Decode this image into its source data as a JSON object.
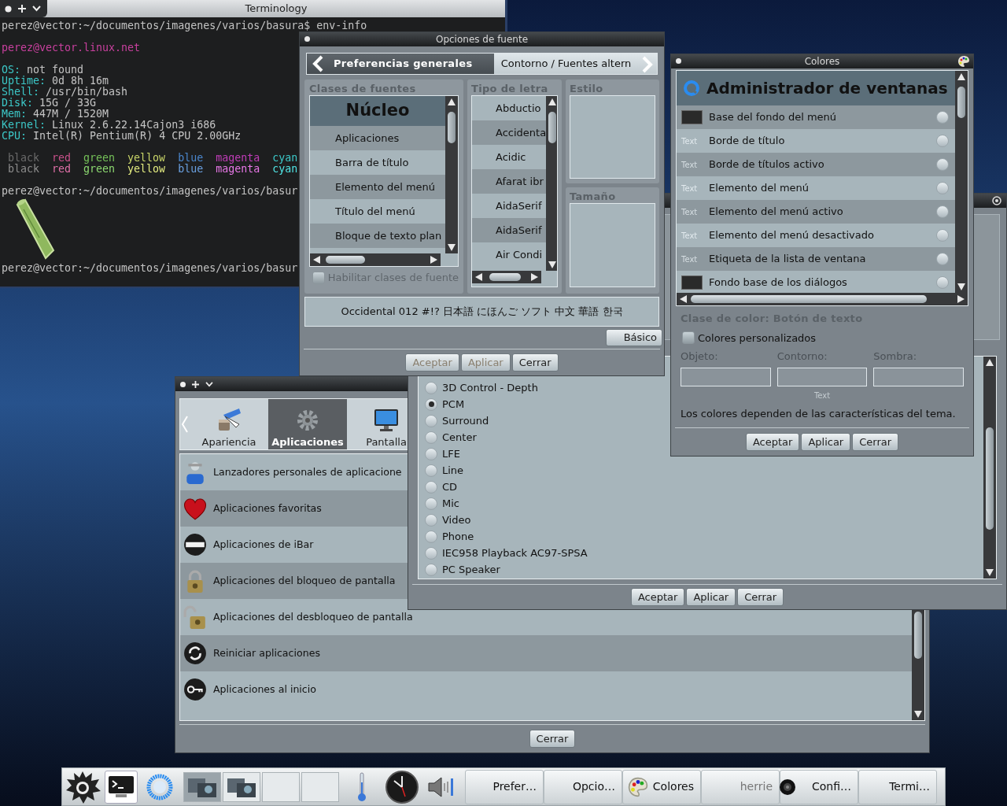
{
  "terminal": {
    "title": "Terminology",
    "lines": [
      {
        "kind": "prompt",
        "text": "perez@vector:~/documentos/imagenes/varios/basura$ env-info"
      },
      {
        "kind": "blank"
      },
      {
        "kind": "host",
        "text": "perez@vector.linux.net"
      },
      {
        "kind": "blank"
      },
      {
        "kind": "info",
        "label": "OS:",
        "value": "not found"
      },
      {
        "kind": "info",
        "label": "Uptime:",
        "value": "0d 8h 16m"
      },
      {
        "kind": "info",
        "label": "Shell:",
        "value": "/usr/bin/bash"
      },
      {
        "kind": "info",
        "label": "Disk:",
        "value": "15G / 33G"
      },
      {
        "kind": "info",
        "label": "Mem:",
        "value": "447M / 1520M"
      },
      {
        "kind": "info",
        "label": "Kernel:",
        "value": "Linux 2.6.22.14Cajon3 i686"
      },
      {
        "kind": "info",
        "label": "CPU:",
        "value": "Intel(R) Pentium(R) 4 CPU 2.00GHz"
      },
      {
        "kind": "blank"
      },
      {
        "kind": "palette",
        "colors": [
          {
            "text": "black",
            "color": "#6a6a6a"
          },
          {
            "text": "red",
            "color": "#c8508a"
          },
          {
            "text": "green",
            "color": "#74c058"
          },
          {
            "text": "yellow",
            "color": "#c8d468"
          },
          {
            "text": "blue",
            "color": "#4a86cc"
          },
          {
            "text": "magenta",
            "color": "#c03cb8"
          },
          {
            "text": "cyan",
            "color": "#3cc8c8"
          }
        ]
      },
      {
        "kind": "palette",
        "colors": [
          {
            "text": "black",
            "color": "#8c8c8c"
          },
          {
            "text": "red",
            "color": "#e070a8"
          },
          {
            "text": "green",
            "color": "#8cd870"
          },
          {
            "text": "yellow",
            "color": "#e4ec80"
          },
          {
            "text": "blue",
            "color": "#6aa0e0"
          },
          {
            "text": "magenta",
            "color": "#e878e8"
          },
          {
            "text": "cyan",
            "color": "#50e4e4"
          }
        ]
      },
      {
        "kind": "blank"
      },
      {
        "kind": "prompt",
        "text": "perez@vector:~/documentos/imagenes/varios/basur"
      },
      {
        "kind": "image"
      },
      {
        "kind": "prompt",
        "text": "perez@vector:~/documentos/imagenes/varios/basur"
      }
    ]
  },
  "settings_window": {
    "tabs": [
      {
        "label": "Apariencia",
        "selected": false
      },
      {
        "label": "Aplicaciones",
        "selected": true
      },
      {
        "label": "Pantalla",
        "selected": false
      }
    ],
    "items": [
      {
        "label": "Lanzadores personales de aplicacione"
      },
      {
        "label": "Aplicaciones favoritas"
      },
      {
        "label": "Aplicaciones de iBar"
      },
      {
        "label": "Aplicaciones del bloqueo de pantalla"
      },
      {
        "label": "Aplicaciones del desbloqueo de pantalla"
      },
      {
        "label": "Reiniciar aplicaciones"
      },
      {
        "label": "Aplicaciones al inicio"
      }
    ],
    "buttons": [
      {
        "label": "Cerrar",
        "disabled": false
      }
    ]
  },
  "mixer_window": {
    "channels": [
      {
        "label": "3D Control - Depth",
        "selected": false
      },
      {
        "label": "PCM",
        "selected": true
      },
      {
        "label": "Surround",
        "selected": false
      },
      {
        "label": "Center",
        "selected": false
      },
      {
        "label": "LFE",
        "selected": false
      },
      {
        "label": "Line",
        "selected": false
      },
      {
        "label": "CD",
        "selected": false
      },
      {
        "label": "Mic",
        "selected": false
      },
      {
        "label": "Video",
        "selected": false
      },
      {
        "label": "Phone",
        "selected": false
      },
      {
        "label": "IEC958 Playback AC97-SPSA",
        "selected": false
      },
      {
        "label": "PC Speaker",
        "selected": false
      }
    ],
    "buttons": [
      {
        "label": "Aceptar",
        "disabled": false
      },
      {
        "label": "Aplicar",
        "disabled": false
      },
      {
        "label": "Cerrar",
        "disabled": false
      }
    ]
  },
  "font_window": {
    "title": "Opciones de fuente",
    "tabs": [
      {
        "label": "Preferencias generales",
        "selected": true
      },
      {
        "label": "Contorno / Fuentes altern",
        "selected": false
      }
    ],
    "classes": {
      "heading": "Clases de fuentes",
      "items": [
        {
          "kind": "header",
          "label": "Núcleo"
        },
        {
          "kind": "item",
          "label": "Aplicaciones"
        },
        {
          "kind": "item",
          "label": "Barra de título"
        },
        {
          "kind": "item",
          "label": "Elemento del menú"
        },
        {
          "kind": "item",
          "label": "Título del menú"
        },
        {
          "kind": "item",
          "label": "Bloque de texto plan"
        }
      ]
    },
    "enable_classes": {
      "label": "Habilitar clases de fuente",
      "checked": false,
      "disabled": true
    },
    "typefaces": {
      "heading": "Tipo de letra",
      "items": [
        {
          "label": "Abductio"
        },
        {
          "label": "Accidenta"
        },
        {
          "label": "Acidic"
        },
        {
          "label": "Afarat ibr"
        },
        {
          "label": "AidaSerif"
        },
        {
          "label": "AidaSerif"
        },
        {
          "label": "Air Condi"
        }
      ]
    },
    "style": {
      "heading": "Estilo"
    },
    "size": {
      "heading": "Tamaño"
    },
    "sample": "Occidental 012 #!? 日本語 にほんご ソフト 中文 華語 한국",
    "basic_button": "Básico",
    "buttons": [
      {
        "label": "Aceptar",
        "disabled": true
      },
      {
        "label": "Aplicar",
        "disabled": true
      },
      {
        "label": "Cerrar",
        "disabled": false
      }
    ]
  },
  "colors_window": {
    "title": "Colores",
    "list_header": "Administrador de ventanas",
    "items": [
      {
        "kind": "swatch",
        "label": "Base del fondo del menú",
        "selected": false
      },
      {
        "kind": "text",
        "sample": "Text",
        "label": "Borde de título",
        "selected": false
      },
      {
        "kind": "text",
        "sample": "Text",
        "label": "Borde de títulos activo",
        "selected": false
      },
      {
        "kind": "text",
        "sample": "Text",
        "label": "Elemento del menú",
        "selected": false
      },
      {
        "kind": "text",
        "sample": "Text",
        "label": "Elemento del menú activo",
        "selected": false
      },
      {
        "kind": "text",
        "sample": "Text",
        "label": "Elemento del menú desactivado",
        "selected": false
      },
      {
        "kind": "text",
        "sample": "Text",
        "label": "Etiqueta de la lista de ventana",
        "selected": false
      },
      {
        "kind": "swatch",
        "label": "Fondo base de los diálogos",
        "selected": false
      }
    ],
    "class_title": "Clase de color: Botón de texto",
    "custom_colors": {
      "label": "Colores personalizados",
      "checked": false
    },
    "fields": [
      {
        "label": "Objeto:"
      },
      {
        "label": "Contorno:"
      },
      {
        "label": "Sombra:"
      }
    ],
    "preview": "Text",
    "note": "Los colores dependen de las características del tema.",
    "buttons": [
      {
        "label": "Aceptar",
        "disabled": false
      },
      {
        "label": "Aplicar",
        "disabled": false
      },
      {
        "label": "Cerrar",
        "disabled": false
      }
    ]
  },
  "taskbar": {
    "tasks": [
      {
        "label": "Prefer…",
        "minimized": false
      },
      {
        "label": "Opcio…",
        "minimized": false
      },
      {
        "label": "Colores",
        "minimized": false
      },
      {
        "label": "herrie",
        "minimized": true
      },
      {
        "label": "Confi…",
        "minimized": false
      },
      {
        "label": "Termi…",
        "minimized": false
      }
    ]
  }
}
